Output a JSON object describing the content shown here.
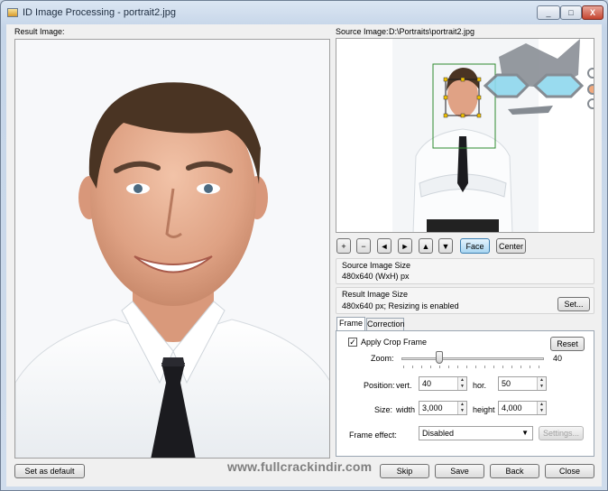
{
  "window": {
    "title": "ID Image Processing - portrait2.jpg",
    "caption_minimize": "_",
    "caption_maximize": "□",
    "caption_close": "X"
  },
  "result": {
    "label": "Result Image:"
  },
  "source": {
    "label": "Source Image:",
    "path": "D:\\Portraits\\portrait2.jpg"
  },
  "toolbar": {
    "zoom_in": "+",
    "zoom_out": "−",
    "left": "◄",
    "right": "►",
    "up": "▲",
    "down": "▼",
    "face": "Face",
    "center": "Center"
  },
  "source_size": {
    "label": "Source Image Size",
    "value": "480x640 (WxH) px"
  },
  "result_size": {
    "label": "Result Image Size",
    "value": "480x640 px; Resizing is enabled",
    "set_button": "Set..."
  },
  "tabs": [
    {
      "label": "Frame"
    },
    {
      "label": "Correction"
    }
  ],
  "frame": {
    "apply_crop_label": "Apply Crop Frame",
    "apply_crop_checked": true,
    "checkmark": "✓",
    "reset_button": "Reset",
    "zoom_label": "Zoom:",
    "zoom_value": "40",
    "zoom_fraction": 0.25,
    "position_label": "Position:",
    "vert_label": "vert.",
    "vert_value": "40",
    "hor_label": "hor.",
    "hor_value": "50",
    "size_label": "Size:",
    "width_label": "width",
    "width_value": "3,000",
    "height_label": "height",
    "height_value": "4,000",
    "frame_effect_label": "Frame effect:",
    "frame_effect_value": "Disabled",
    "settings_button": "Settings..."
  },
  "footer": {
    "set_default_button": "Set as default",
    "skip_button": "Skip",
    "save_button": "Save",
    "back_button": "Back",
    "close_button": "Close"
  },
  "watermark": "www.fullcrackindir.com",
  "colors": {
    "face_button_active": "#a9d6f2",
    "face_box": "#2e8b2e",
    "crop_handles": "#f2c200"
  }
}
